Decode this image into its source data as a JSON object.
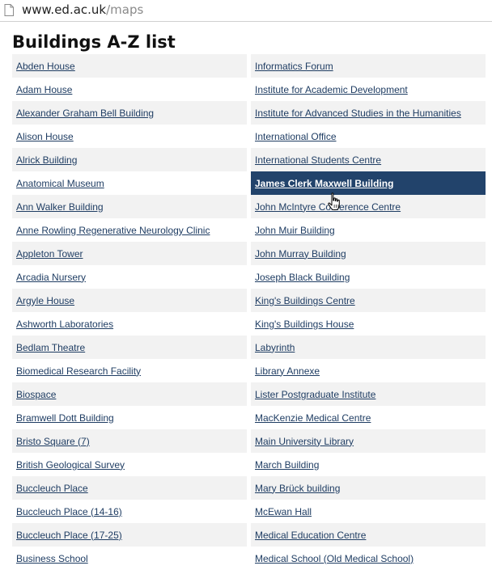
{
  "browser": {
    "url_host": "www.ed.ac.uk",
    "url_path": "/maps"
  },
  "page": {
    "title": "Buildings A-Z list"
  },
  "colors": {
    "link": "#1f3d63",
    "row_alt": "#f2f2f2",
    "active_bg": "#22436b"
  },
  "columns": {
    "left": [
      "Abden House",
      "Adam House",
      "Alexander Graham Bell Building",
      "Alison House",
      "Alrick Building",
      "Anatomical Museum",
      "Ann Walker Building",
      "Anne Rowling Regenerative Neurology Clinic",
      "Appleton Tower",
      "Arcadia Nursery",
      "Argyle House",
      "Ashworth Laboratories",
      "Bedlam Theatre",
      "Biomedical Research Facility",
      "Biospace",
      "Bramwell Dott Building",
      "Bristo Square (7)",
      "British Geological Survey",
      "Buccleuch Place",
      "Buccleuch Place (14-16)",
      "Buccleuch Place (17-25)",
      "Business School"
    ],
    "right": [
      "Informatics Forum",
      "Institute for Academic Development",
      "Institute for Advanced Studies in the Humanities",
      "International Office",
      "International Students Centre",
      "James Clerk Maxwell Building",
      "John McIntyre Conference Centre",
      "John Muir Building",
      "John Murray Building",
      "Joseph Black Building",
      "King's Buildings Centre",
      "King's Buildings House",
      "Labyrinth",
      "Library Annexe",
      "Lister Postgraduate Institute",
      "MacKenzie Medical Centre",
      "Main University Library",
      "March Building",
      "Mary Brück building",
      "McEwan Hall",
      "Medical Education Centre",
      "Medical School (Old Medical School)"
    ],
    "active_item": "James Clerk Maxwell Building"
  }
}
